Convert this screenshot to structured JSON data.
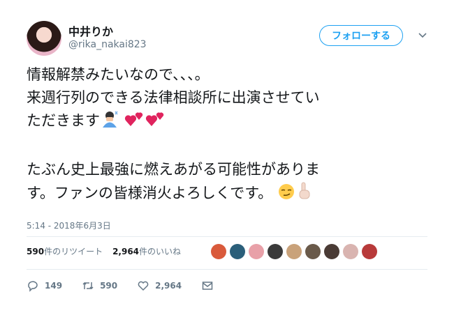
{
  "user": {
    "display_name": "中井りか",
    "handle": "@rika_nakai823"
  },
  "follow_label": "フォローする",
  "tweet": {
    "line1": "情報解禁みたいなので、、、。",
    "line2": "来週行列のできる法律相談所に出演させてい",
    "line3": "ただきます",
    "line4": "たぶん史上最強に燃えあがる可能性がありま",
    "line5": "す。ファンの皆様消火よろしくです。",
    "emojis": [
      "person-bowing-icon",
      "two-hearts-icon",
      "two-hearts-icon",
      "smirking-face-icon",
      "pointing-up-icon"
    ]
  },
  "timestamp": "5:14 - 2018年6月3日",
  "stats": {
    "retweets_count": "590",
    "retweets_label": "件のリツイート",
    "likes_count": "2,964",
    "likes_label": "件のいいね"
  },
  "likers": [
    "#d95a3b",
    "#2b5f7a",
    "#e8a0a8",
    "#3a3a3a",
    "#c9a27a",
    "#6a5a4a",
    "#4a3b35",
    "#d9b4b0",
    "#b83a3a"
  ],
  "actions": {
    "reply_count": "149",
    "retweet_count": "590",
    "like_count": "2,964"
  },
  "colors": {
    "accent": "#1da1f2",
    "text": "#14171a",
    "muted": "#657786",
    "heart": "#e0245e"
  }
}
